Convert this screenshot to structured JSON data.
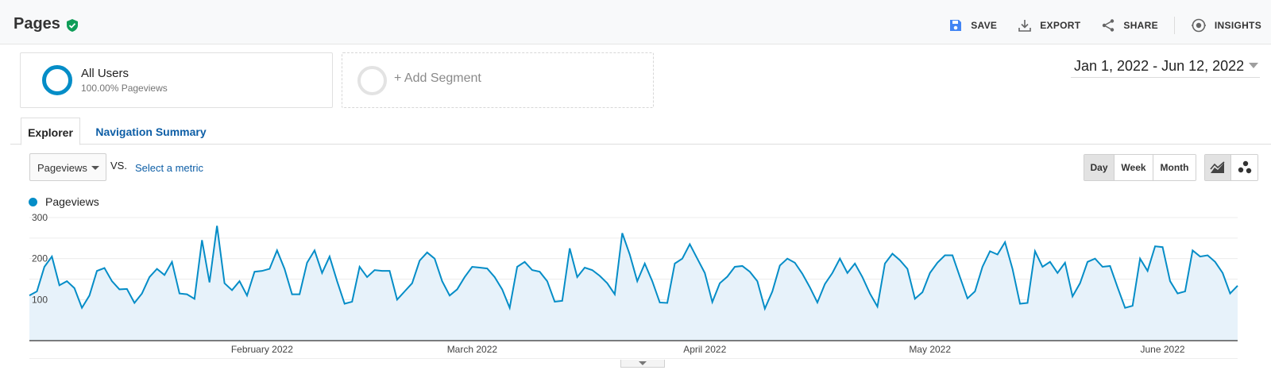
{
  "header": {
    "title": "Pages",
    "actions": [
      {
        "label": "SAVE",
        "icon": "save-icon"
      },
      {
        "label": "EXPORT",
        "icon": "download-icon"
      },
      {
        "label": "SHARE",
        "icon": "share-icon"
      },
      {
        "label": "INSIGHTS",
        "icon": "insights-icon"
      }
    ]
  },
  "segments": {
    "active": {
      "name": "All Users",
      "sub": "100.00% Pageviews"
    },
    "add_label": "+ Add Segment"
  },
  "date_range": "Jan 1, 2022 - Jun 12, 2022",
  "tabs": [
    {
      "label": "Explorer",
      "active": true
    },
    {
      "label": "Navigation Summary",
      "active": false
    }
  ],
  "metric": {
    "selected": "Pageviews",
    "vs": "VS.",
    "select_label": "Select a metric"
  },
  "granularity": [
    {
      "label": "Day",
      "active": true
    },
    {
      "label": "Week",
      "active": false
    },
    {
      "label": "Month",
      "active": false
    }
  ],
  "colors": {
    "accent": "#058dc7",
    "link": "#0d5ea6",
    "verified": "#0f9d58",
    "save": "#4285f4"
  },
  "chart_data": {
    "type": "area",
    "series": [
      {
        "name": "Pageviews",
        "values": [
          110,
          120,
          180,
          205,
          135,
          145,
          128,
          80,
          110,
          170,
          177,
          145,
          125,
          126,
          92,
          115,
          155,
          175,
          160,
          192,
          115,
          113,
          102,
          245,
          142,
          280,
          140,
          123,
          145,
          110,
          168,
          170,
          175,
          220,
          175,
          113,
          113,
          190,
          220,
          165,
          205,
          145,
          90,
          95,
          180,
          155,
          172,
          170,
          170,
          100,
          120,
          140,
          195,
          215,
          200,
          145,
          110,
          125,
          155,
          180,
          178,
          176,
          155,
          125,
          80,
          180,
          192,
          172,
          168,
          145,
          95,
          97,
          225,
          155,
          178,
          172,
          158,
          140,
          113,
          262,
          210,
          145,
          188,
          145,
          93,
          92,
          188,
          200,
          235,
          200,
          165,
          94,
          140,
          156,
          180,
          182,
          168,
          145,
          78,
          120,
          183,
          200,
          190,
          163,
          130,
          93,
          138,
          165,
          200,
          165,
          188,
          155,
          115,
          83,
          188,
          212,
          196,
          175,
          102,
          118,
          165,
          190,
          208,
          208,
          155,
          103,
          120,
          180,
          218,
          210,
          240,
          175,
          90,
          92,
          218,
          180,
          192,
          165,
          190,
          108,
          140,
          192,
          200,
          180,
          182,
          130,
          80,
          85,
          200,
          170,
          230,
          228,
          145,
          115,
          120,
          220,
          205,
          208,
          192,
          165,
          115,
          134
        ]
      }
    ],
    "start_date": "2022-01-01",
    "end_date": "2022-06-12",
    "ylim": [
      0,
      300
    ],
    "y_ticks": [
      100,
      200,
      300
    ],
    "x_ticks": [
      {
        "label": "February 2022",
        "index": 31
      },
      {
        "label": "March 2022",
        "index": 59
      },
      {
        "label": "April 2022",
        "index": 90
      },
      {
        "label": "May 2022",
        "index": 120
      },
      {
        "label": "June 2022",
        "index": 151
      }
    ],
    "legend_position": "top-left",
    "grid": true
  }
}
